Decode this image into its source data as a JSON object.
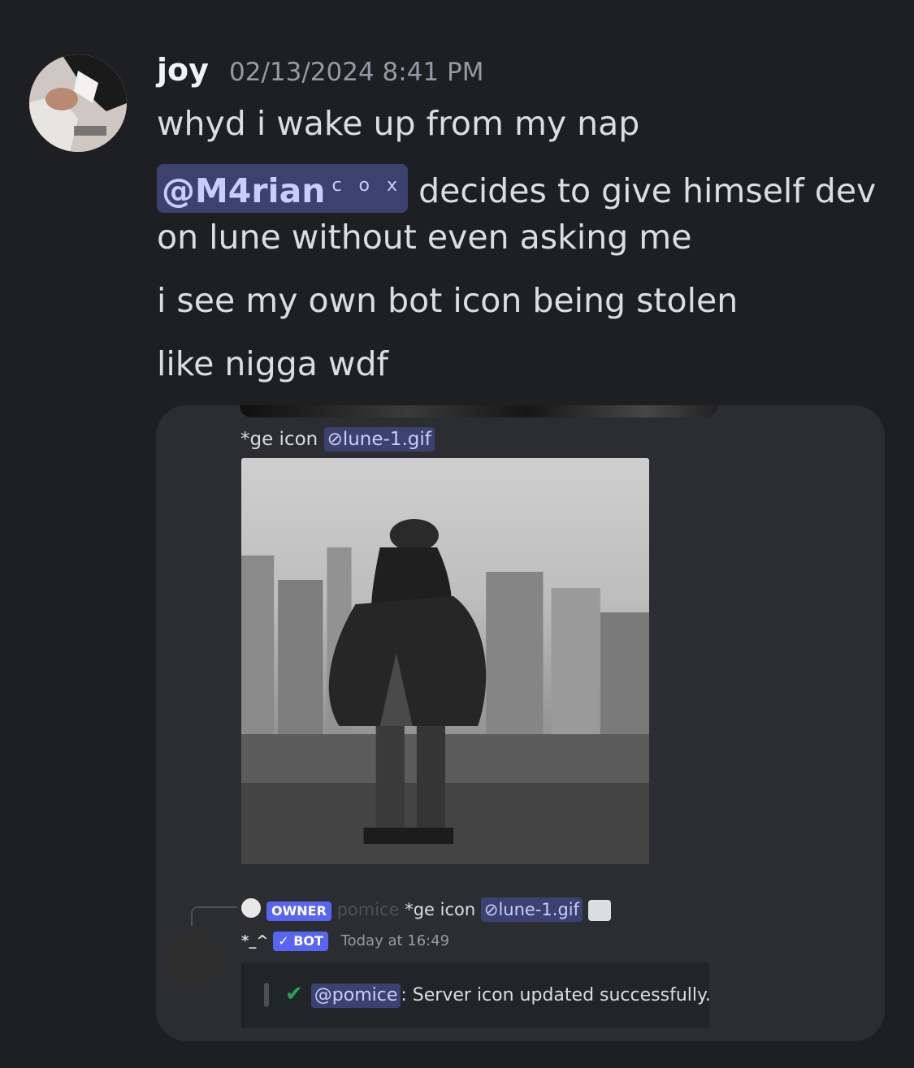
{
  "message": {
    "author": "joy",
    "timestamp": "02/13/2024 8:41 PM",
    "lines": [
      "whyd i wake up from my nap",
      "decides to give himself dev",
      "on lune without even asking me",
      "i see my own bot icon being stolen",
      "like nigga wdf"
    ],
    "mention": {
      "name": "@M4rian",
      "suffix": "c o x"
    }
  },
  "screenshot_card": {
    "top_caption": "*ge icon",
    "attachment_name": "lune-1.gif",
    "reply": {
      "owner_tag": "OWNER",
      "reply_username": "pomice",
      "reply_text": "*ge icon",
      "attachment_name": "lune-1.gif",
      "image_icon": "image-icon"
    },
    "bot": {
      "name": "*_^",
      "tag_check": "✓",
      "tag": "BOT",
      "timestamp": "Today at 16:49"
    },
    "embed": {
      "check": "✔",
      "mention": "@pomice",
      "text": ": Server icon updated successfully."
    }
  },
  "colors": {
    "background": "#1e1f22",
    "card": "#2b2d31",
    "mention_bg": "#3c4270",
    "mention_text": "#c9cdfb",
    "bot_tag": "#5865f2",
    "success": "#23a55a"
  }
}
